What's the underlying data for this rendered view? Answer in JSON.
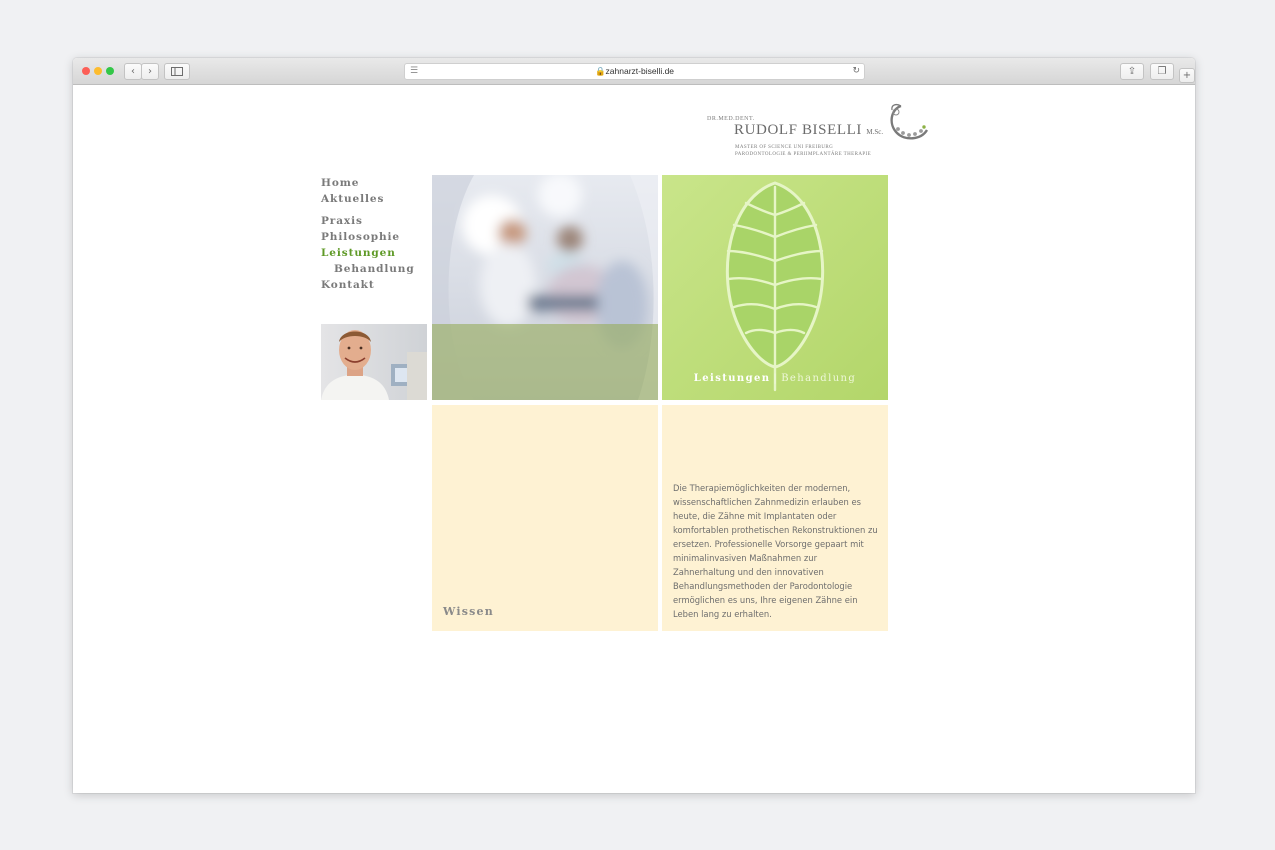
{
  "browser": {
    "url": "zahnarzt-biselli.de"
  },
  "logo": {
    "prefix": "DR.MED.DENT.",
    "name": "RUDOLF BISELLI",
    "suffix": "M.Sc.",
    "line1": "MASTER OF SCIENCE UNI FREIBURG",
    "line2": "PARODONTOLOGIE & PERIIMPLANTÄRE THERAPIE"
  },
  "nav": {
    "home": "Home",
    "aktuelles": "Aktuelles",
    "praxis": "Praxis",
    "philosophie": "Philosophie",
    "leistungen": "Leistungen",
    "behandlung": "Behandlung",
    "kontakt": "Kontakt",
    "active_color": "#5f9a27"
  },
  "feature": {
    "caption_primary": "Leistungen",
    "separator": "|",
    "caption_secondary": "Behandlung"
  },
  "wissen": {
    "label": "Wissen"
  },
  "body_text": "Die Therapiemöglichkeiten der modernen, wissenschaftlichen Zahnmedizin erlauben es heute, die Zähne mit Implantaten oder komfortablen prothetischen Rekonstruktionen zu ersetzen. Professionelle Vorsorge gepaart mit minimalinvasiven Maßnahmen zur Zahnerhaltung und den innovativen Behandlungsmethoden der Parodontologie ermöglichen es uns, Ihre eigenen Zähne ein Leben lang zu erhalten.",
  "colors": {
    "accent_green": "#5f9a27",
    "leaf_background": "#c2e07e",
    "cream": "#fef2d3"
  }
}
